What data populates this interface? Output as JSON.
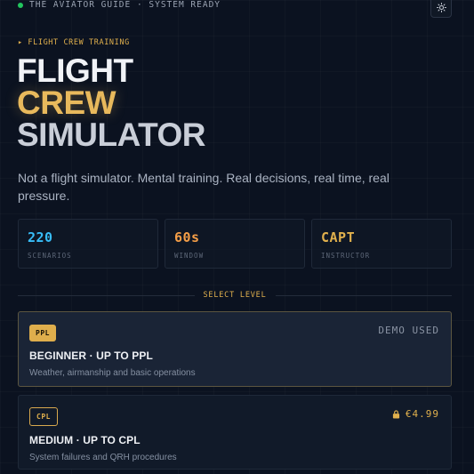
{
  "topbar": {
    "status_text": "THE AVIATOR GUIDE · SYSTEM READY",
    "status_color": "#22c55e",
    "theme_icon": "sun-icon"
  },
  "hero": {
    "kicker": "▸ FLIGHT CREW TRAINING",
    "title_line1": "FLIGHT",
    "title_line2": "CREW",
    "title_line3": "SIMULATOR",
    "description": "Not a flight simulator. Mental training. Real decisions, real time, real pressure."
  },
  "stats": [
    {
      "value": "220",
      "label": "SCENARIOS",
      "color": "#38bdf8"
    },
    {
      "value": "60s",
      "label": "WINDOW",
      "color": "#f59e47"
    },
    {
      "value": "CAPT",
      "label": "INSTRUCTOR",
      "color": "#e0b04d"
    }
  ],
  "divider_label": "SELECT LEVEL",
  "levels": [
    {
      "badge": "PPL",
      "title": "BEGINNER · UP TO PPL",
      "subtitle": "Weather, airmanship and basic operations",
      "status": "DEMO USED"
    },
    {
      "badge": "CPL",
      "title": "MEDIUM · UP TO CPL",
      "subtitle": "System failures and QRH procedures",
      "price": "€4.99",
      "lock_icon": "lock-icon"
    }
  ],
  "colors": {
    "accent": "#e0b04d",
    "background": "#0b1220"
  }
}
